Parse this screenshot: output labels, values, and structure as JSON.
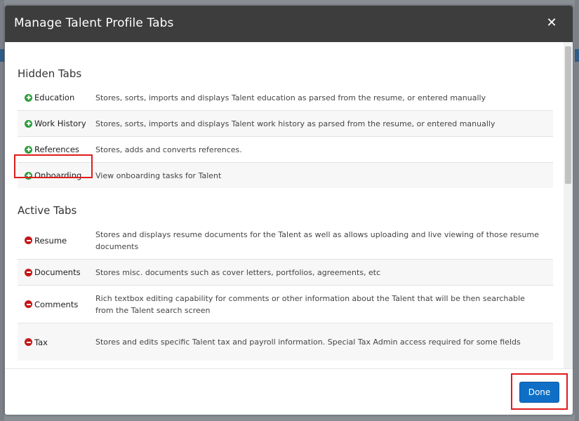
{
  "modal": {
    "title": "Manage Talent Profile Tabs",
    "close_glyph": "✕"
  },
  "hidden_section": {
    "title": "Hidden Tabs",
    "rows": [
      {
        "name": "Education",
        "icon": "add-circle-icon",
        "description": "Stores, sorts, imports and displays Talent education as parsed from the resume, or entered manually"
      },
      {
        "name": "Work History",
        "icon": "add-circle-icon",
        "description": "Stores, sorts, imports and displays Talent work history as parsed from the resume, or entered manually"
      },
      {
        "name": "References",
        "icon": "add-circle-icon",
        "description": "Stores, adds and converts references."
      },
      {
        "name": "Onboarding",
        "icon": "add-circle-icon",
        "description": "View onboarding tasks for Talent"
      }
    ]
  },
  "active_section": {
    "title": "Active Tabs",
    "rows": [
      {
        "name": "Resume",
        "icon": "remove-circle-icon",
        "description": "Stores and displays resume documents for the Talent as well as allows uploading and live viewing of those resume documents"
      },
      {
        "name": "Documents",
        "icon": "remove-circle-icon",
        "description": "Stores misc. documents such as cover letters, portfolios, agreements, etc"
      },
      {
        "name": "Comments",
        "icon": "remove-circle-icon",
        "description": "Rich textbox editing capability for comments or other information about the Talent that will be then searchable from the Talent search screen"
      },
      {
        "name": "Tax",
        "icon": "remove-circle-icon",
        "description": "Stores and edits specific Talent tax and payroll information. Special Tax Admin access required for some fields"
      }
    ]
  },
  "footer": {
    "done_label": "Done"
  },
  "colors": {
    "header_bg": "#3d3d3d",
    "add_icon": "#2e9e3e",
    "remove_icon": "#c21818",
    "primary_button": "#0f6fc6",
    "highlight": "#e01b1b"
  }
}
